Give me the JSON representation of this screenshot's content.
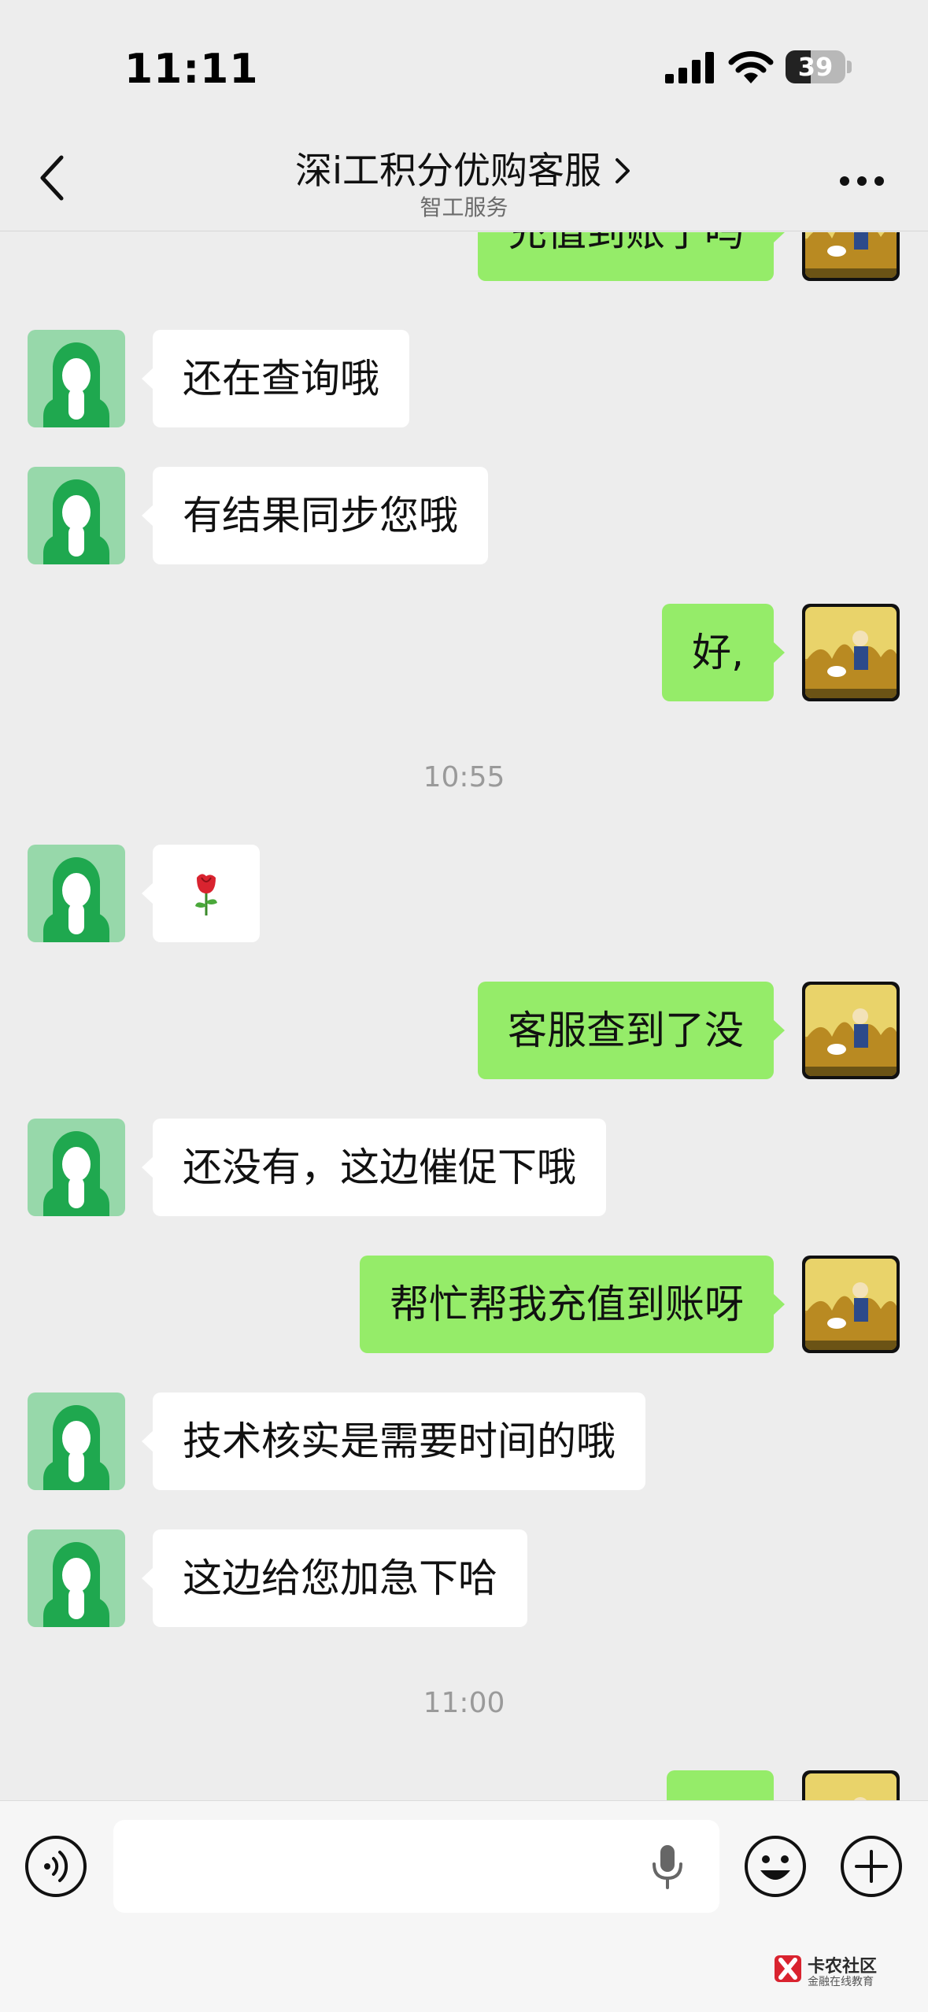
{
  "status_bar": {
    "time": "11:11",
    "battery": "39"
  },
  "header": {
    "title": "深i工积分优购客服",
    "subtitle": "智工服务"
  },
  "messages": [
    {
      "side": "right",
      "text": "充值到账了吗"
    },
    {
      "side": "left",
      "text": "还在查询哦"
    },
    {
      "side": "left",
      "text": "有结果同步您哦"
    },
    {
      "side": "right",
      "text": "好,"
    },
    {
      "type": "time",
      "text": "10:55"
    },
    {
      "side": "left",
      "text": "🌹",
      "emoji": "rose"
    },
    {
      "side": "right",
      "text": "客服查到了没"
    },
    {
      "side": "left",
      "text": "还没有，这边催促下哦"
    },
    {
      "side": "right",
      "text": "帮忙帮我充值到账呀"
    },
    {
      "side": "left",
      "text": "技术核实是需要时间的哦"
    },
    {
      "side": "left",
      "text": "这边给您加急下哈"
    },
    {
      "type": "time",
      "text": "11:00"
    }
  ],
  "colors": {
    "sent_bubble": "#95ec69",
    "received_bubble": "#ffffff",
    "background": "#ededed",
    "avatar_green": "#1fa84f"
  },
  "input": {
    "placeholder": ""
  },
  "watermark": {
    "title": "卡农社区",
    "subtitle": "金融在线教育"
  }
}
